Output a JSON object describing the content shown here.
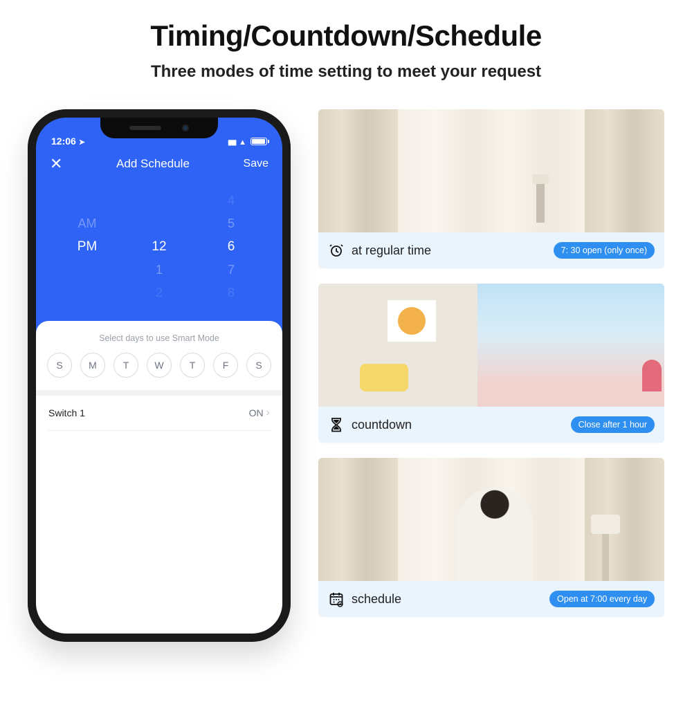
{
  "headline": "Timing/Countdown/Schedule",
  "subhead": "Three modes of time setting to meet your request",
  "phone": {
    "status_time": "12:06",
    "nav": {
      "close": "✕",
      "title": "Add Schedule",
      "save": "Save"
    },
    "picker": {
      "ampm": {
        "above": "AM",
        "selected": "PM",
        "below": ""
      },
      "hour": {
        "above": "",
        "selected": "12",
        "below1": "1",
        "below2": "2"
      },
      "minute": {
        "above2": "4",
        "above": "5",
        "selected": "6",
        "below1": "7",
        "below2": "8"
      }
    },
    "sheet_hint": "Select days to use Smart Mode",
    "days": [
      "S",
      "M",
      "T",
      "W",
      "T",
      "F",
      "S"
    ],
    "switch": {
      "name": "Switch 1",
      "value": "ON"
    }
  },
  "cards": [
    {
      "icon": "clock-alarm-icon",
      "label": "at regular time",
      "badge": "7: 30 open (only once)"
    },
    {
      "icon": "hourglass-icon",
      "label": "countdown",
      "badge": "Close after 1 hour"
    },
    {
      "icon": "calendar-icon",
      "label": "schedule",
      "badge": "Open at 7:00 every day"
    }
  ]
}
